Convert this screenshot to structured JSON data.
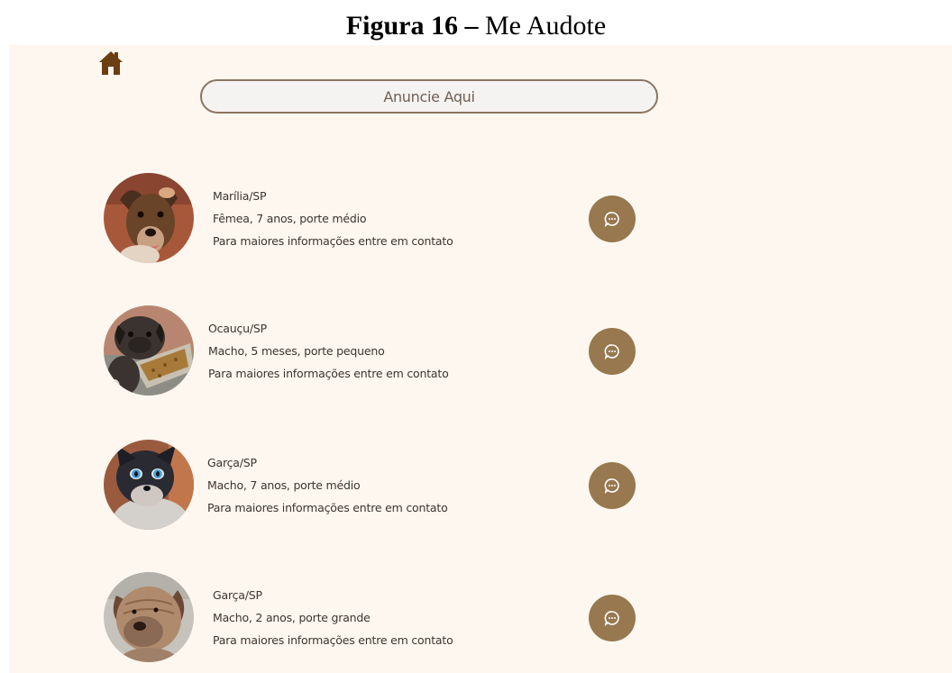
{
  "caption": {
    "lead": "Figura 16 –",
    "title": "Me Audote"
  },
  "header": {
    "announce_label": "Anuncie Aqui"
  },
  "listings": [
    {
      "location": "Marília/SP",
      "details": "Fêmea, 7 anos, porte médio",
      "contact": "Para maiores informações entre em contato"
    },
    {
      "location": "Ocauçu/SP",
      "details": "Macho, 5 meses, porte pequeno",
      "contact": "Para maiores informações entre em contato"
    },
    {
      "location": "Garça/SP",
      "details": "Macho, 7 anos, porte médio",
      "contact": "Para maiores informações entre em contato"
    },
    {
      "location": "Garça/SP",
      "details": "Macho, 2 anos, porte grande",
      "contact": "Para maiores informações entre em contato"
    }
  ],
  "icons": {
    "home": "home-icon",
    "chat": "chat-bubble-icon"
  },
  "colors": {
    "background": "#fdf7ef",
    "accent": "#97784f",
    "home_icon": "#6b3e12",
    "button_border": "#8a7560"
  }
}
